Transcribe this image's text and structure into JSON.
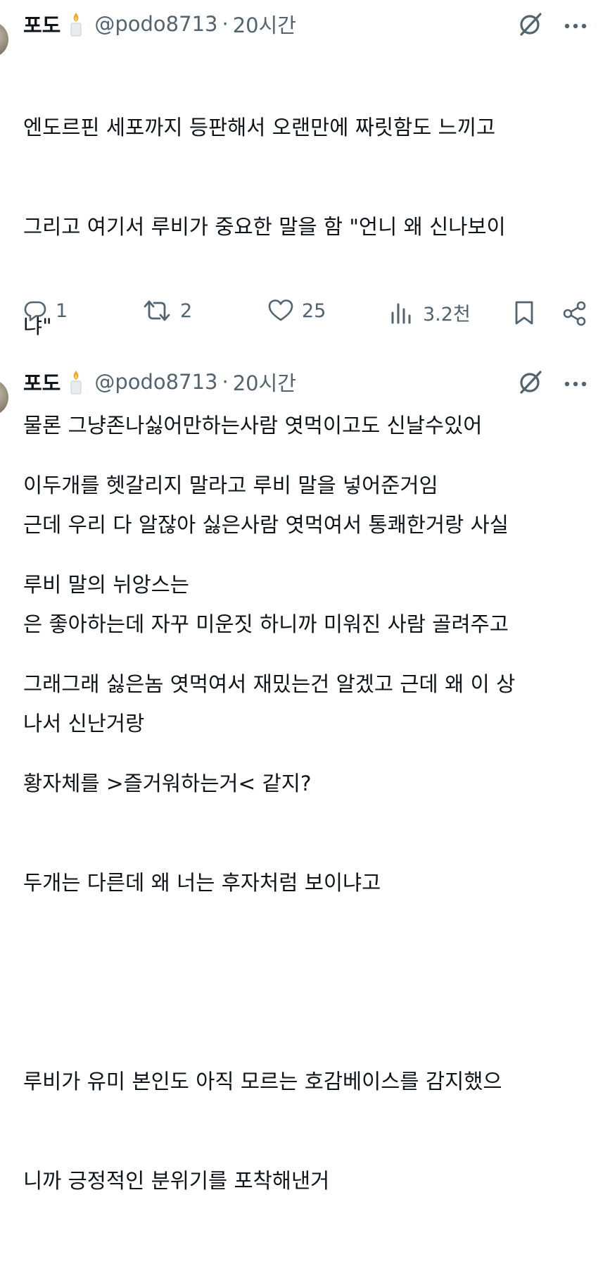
{
  "tweets": [
    {
      "author_name": "포도",
      "handle": "@podo8713",
      "separator": "·",
      "time": "20시간",
      "lines": [
        "엔도르핀 세포까지 등판해서 오랜만에 짜릿함도 느끼고",
        "그리고 여기서 루비가 중요한 말을 함 \"언니 왜 신나보이",
        "냐\"",
        "물론 그냥존나싫어만하는사람 엿먹이고도 신날수있어",
        "근데 우리 다 알잖아 싫은사람 엿먹여서 통쾌한거랑 사실",
        "은 좋아하는데 자꾸 미운짓 하니까 미워진 사람 골려주고",
        "나서 신난거랑"
      ],
      "replies": "1",
      "reposts": "2",
      "likes": "25",
      "views": "3.2천"
    },
    {
      "author_name": "포도",
      "handle": "@podo8713",
      "separator": "·",
      "time": "20시간",
      "lines": [
        "이두개를 헷갈리지 말라고 루비 말을 넣어준거임",
        "루비 말의 뉘앙스는",
        "그래그래 싫은놈 엿먹여서 재밌는건 알겠고 근데 왜 이 상",
        "황자체를 >즐거워하는거< 같지?",
        "두개는 다른데 왜 너는 후자처럼 보이냐고",
        "",
        "루비가 유미 본인도 아직 모르는 호감베이스를 감지했으",
        "니까 긍정적인 분위기를 포착해낸거"
      ]
    }
  ],
  "icons": {
    "name_emoji": "candle-icon",
    "grok": "grok-icon",
    "more": "more-icon",
    "reply": "reply-icon",
    "repost": "repost-icon",
    "like": "like-icon",
    "views": "views-icon",
    "bookmark": "bookmark-icon",
    "share": "share-icon"
  },
  "colors": {
    "text": "#0f1419",
    "secondary": "#536471",
    "background": "#ffffff",
    "candle_flame": "#f7a325"
  }
}
